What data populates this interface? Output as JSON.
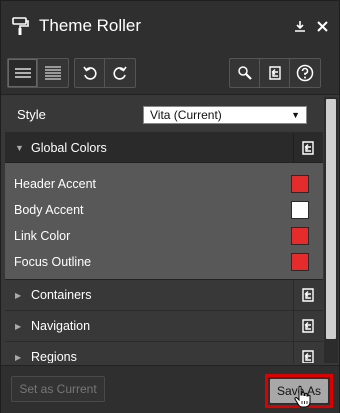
{
  "window": {
    "title": "Theme Roller"
  },
  "icons": {
    "app": "paint-roller-icon",
    "dock": "download-icon",
    "close": "close-icon",
    "view_list": "hamburger-list-icon",
    "view_grid": "dense-list-icon",
    "undo": "undo-icon",
    "redo": "redo-icon",
    "search": "search-icon",
    "reset": "reset-icon",
    "help": "help-icon"
  },
  "style": {
    "label": "Style",
    "selected": "Vita (Current)"
  },
  "global_colors": {
    "title": "Global Colors",
    "items": [
      {
        "label": "Header Accent",
        "color": "#e52b2b"
      },
      {
        "label": "Body Accent",
        "color": "#ffffff"
      },
      {
        "label": "Link Color",
        "color": "#e52b2b"
      },
      {
        "label": "Focus Outline",
        "color": "#e52b2b"
      }
    ]
  },
  "sections": [
    {
      "title": "Containers"
    },
    {
      "title": "Navigation"
    },
    {
      "title": "Regions"
    }
  ],
  "footer": {
    "set_current_label": "Set as Current",
    "save_as_label": "Save As"
  }
}
